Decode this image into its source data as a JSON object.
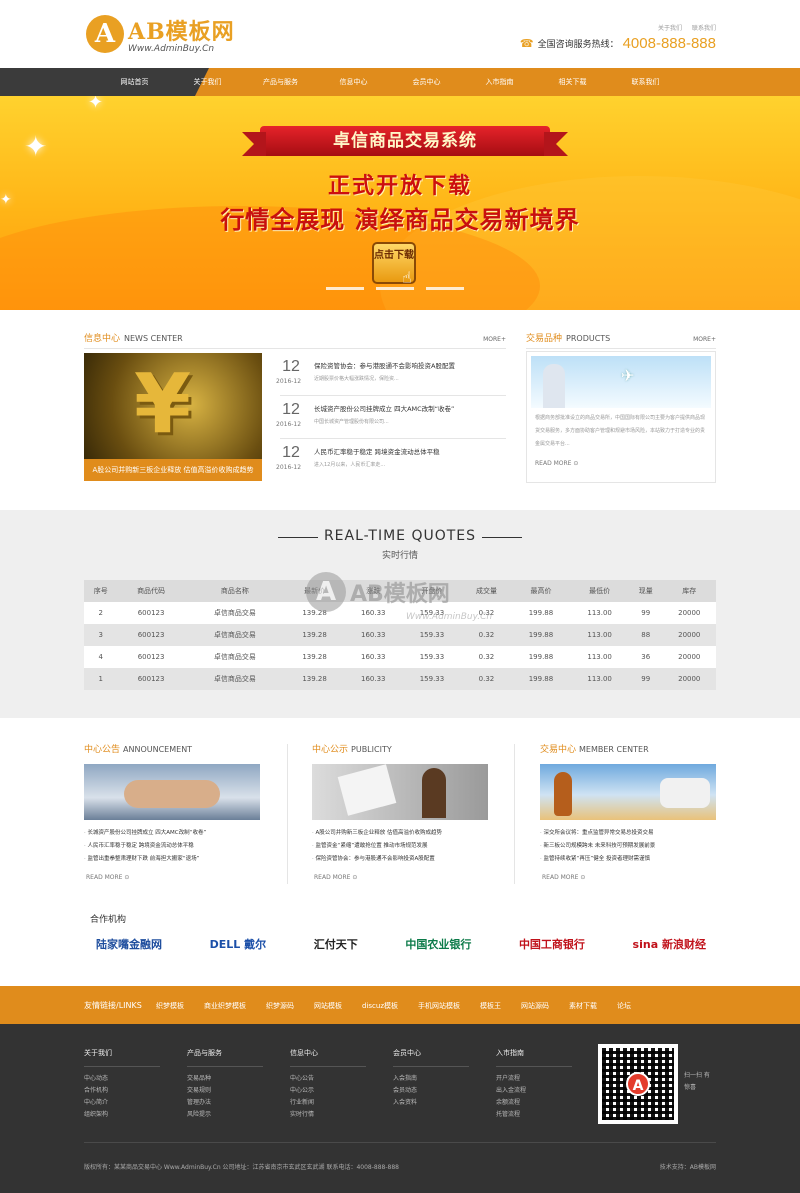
{
  "header": {
    "logo_mark": "A",
    "logo_text": "AB模板网",
    "logo_url": "Www.AdminBuy.Cn",
    "toplinks": [
      "关于我们",
      "联系我们"
    ],
    "hotline_label": "全国咨询服务热线：",
    "hotline_number": "4008-888-888"
  },
  "nav": [
    "网站首页",
    "关于我们",
    "产品与服务",
    "信息中心",
    "会员中心",
    "入市指南",
    "相关下载",
    "联系我们"
  ],
  "banner": {
    "ribbon": "卓信商品交易系统",
    "line1": "正式开放下载",
    "line2": "行情全展现  演绎商品交易新境界",
    "button": "点击下载"
  },
  "news": {
    "title_cn": "信息中心",
    "title_en": "NEWS CENTER",
    "more": "MORE+",
    "image_caption": "A股公司并购新三板企业释放 估值高溢价收购成趋势",
    "items": [
      {
        "day": "12",
        "ym": "2016-12",
        "title": "保险资管协会：参与港股通不会影响投资A股配置",
        "desc": "近期股票价格大幅涨跌情况，保险资..."
      },
      {
        "day": "12",
        "ym": "2016-12",
        "title": "长城资产股份公司挂牌成立 四大AMC改制“收卷”",
        "desc": "中国长城资产管理股份有限公司..."
      },
      {
        "day": "12",
        "ym": "2016-12",
        "title": "人民币汇率稳于稳定 跨境资金流动总体平稳",
        "desc": "进入12月以来，人民币汇率走..."
      }
    ]
  },
  "products": {
    "title_cn": "交易品种",
    "title_en": "PRODUCTS",
    "more": "MORE+",
    "desc": "根据商务部批准设立的商品交易所，中国国际有限公司主要为客户提供商品现货交易服务，多方面协助客户管理和规避市场风险，本站致力于打造专业的贵金属交易平台...",
    "read_more": "READ MORE"
  },
  "quotes": {
    "title_en": "REAL-TIME QUOTES",
    "title_cn": "实时行情",
    "columns": [
      "序号",
      "商品代码",
      "商品名称",
      "最新价",
      "涨跌",
      "开盘价",
      "成交量",
      "最高价",
      "最低价",
      "现量",
      "库存"
    ],
    "rows": [
      [
        "2",
        "600123",
        "卓信商品交易",
        "139.28",
        "160.33",
        "159.33",
        "0.32",
        "199.88",
        "113.00",
        "99",
        "20000"
      ],
      [
        "3",
        "600123",
        "卓信商品交易",
        "139.28",
        "160.33",
        "159.33",
        "0.32",
        "199.88",
        "113.00",
        "88",
        "20000"
      ],
      [
        "4",
        "600123",
        "卓信商品交易",
        "139.28",
        "160.33",
        "159.33",
        "0.32",
        "199.88",
        "113.00",
        "36",
        "20000"
      ],
      [
        "1",
        "600123",
        "卓信商品交易",
        "139.28",
        "160.33",
        "159.33",
        "0.32",
        "199.88",
        "113.00",
        "99",
        "20000"
      ]
    ],
    "watermark_text": "AB模板网",
    "watermark_url": "Www.AdminBuy.Cn"
  },
  "cols": [
    {
      "cn": "中心公告",
      "en": "ANNOUNCEMENT",
      "items": [
        "长城资产股份公司挂牌成立 四大AMC改制“收卷”",
        "人民币汇率稳于稳定 跨境资金流动总体平稳",
        "监管出重拳整肃理财下跌 前海担大搬家“退场”"
      ],
      "more": "READ MORE"
    },
    {
      "cn": "中心公示",
      "en": "PUBLICITY",
      "items": [
        "A股公司并购新三板企业释放 估值高溢价收购成趋势",
        "监管资金“紧缩”遭敢抢位置 推动市场规范发展",
        "保险资管协会：参与港股通不会影响投资A股配置"
      ],
      "more": "READ MORE"
    },
    {
      "cn": "交易中心",
      "en": "MEMBER CENTER",
      "items": [
        "深交所会议将：重点监管异常交易总投资交易",
        "新三板公司规模跨未 未来科技可预期发展前景",
        "监管持续收紧“再压”健全 投资者理财需谨慎"
      ],
      "more": "READ MORE"
    }
  ],
  "partners": {
    "title": "合作机构",
    "logos": [
      "陆家嘴金融网",
      "DELL 戴尔",
      "汇付天下",
      "中国农业银行",
      "中国工商银行",
      "sina 新浪财经"
    ]
  },
  "links": {
    "label": "友情链接/LINKS",
    "items": [
      "织梦模板",
      "商业织梦模板",
      "织梦源码",
      "网站模板",
      "discuz模板",
      "手机网站模板",
      "模板王",
      "网站源码",
      "素材下载",
      "论坛"
    ]
  },
  "footer": {
    "cols": [
      {
        "title": "关于我们",
        "items": [
          "中心动态",
          "合作机构",
          "中心简介",
          "组织架构"
        ]
      },
      {
        "title": "产品与服务",
        "items": [
          "交易品种",
          "交易规则",
          "管理办法",
          "风险提示"
        ]
      },
      {
        "title": "信息中心",
        "items": [
          "中心公告",
          "中心公示",
          "行业新闻",
          "实时行情"
        ]
      },
      {
        "title": "会员中心",
        "items": [
          "入会指南",
          "会员动态",
          "入会资料"
        ]
      },
      {
        "title": "入市指南",
        "items": [
          "开户流程",
          "出入金流程",
          "余额流程",
          "托管流程"
        ]
      }
    ],
    "qr_mark": "A",
    "qr_text": "扫一扫 有惊喜",
    "copyright": "版权所有：某某商品交易中心 Www.AdminBuy.Cn  公司地址：江苏省南京市玄武区玄武湖  联系电话：4008-888-888",
    "support": "技术支持：AB模板网"
  },
  "colors": {
    "accent": "#e08c1c",
    "nav_dark": "#3b3b3b",
    "price_red": "#e43c2c",
    "footer_bg": "#333333"
  }
}
